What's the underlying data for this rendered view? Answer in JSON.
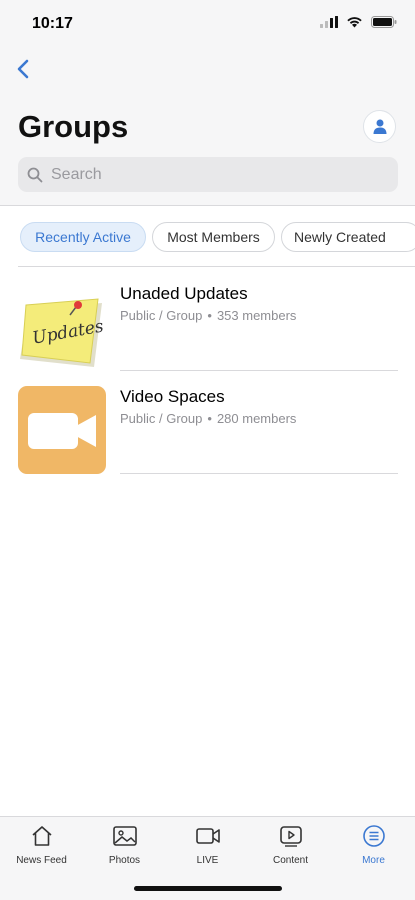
{
  "status_bar": {
    "time": "10:17"
  },
  "header": {
    "title": "Groups"
  },
  "search": {
    "placeholder": "Search"
  },
  "filters": [
    {
      "label": "Recently Active",
      "active": true
    },
    {
      "label": "Most Members",
      "active": false
    },
    {
      "label": "Newly Created",
      "active": false
    }
  ],
  "groups": [
    {
      "name": "Unaded Updates",
      "visibility": "Public / Group",
      "members": "353 members",
      "thumb_text": "Updates"
    },
    {
      "name": "Video Spaces",
      "visibility": "Public / Group",
      "members": "280 members"
    }
  ],
  "tabs": [
    {
      "label": "News Feed",
      "icon": "home-icon"
    },
    {
      "label": "Photos",
      "icon": "photos-icon"
    },
    {
      "label": "LIVE",
      "icon": "video-camera-icon"
    },
    {
      "label": "Content",
      "icon": "play-icon"
    },
    {
      "label": "More",
      "icon": "menu-icon",
      "active": true
    }
  ],
  "colors": {
    "accent": "#3b78d1",
    "video_thumb": "#f0b766",
    "sticky_note": "#f4ec7a"
  }
}
